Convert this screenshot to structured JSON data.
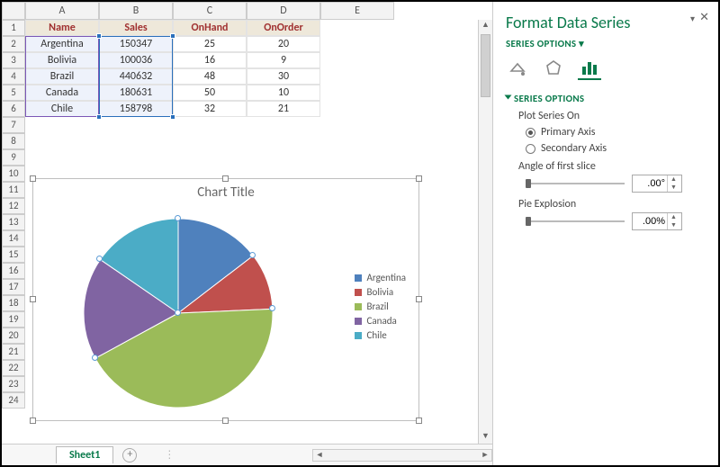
{
  "columns": [
    "A",
    "B",
    "C",
    "D",
    "E"
  ],
  "rowCount": 24,
  "table": {
    "headers": [
      "Name",
      "Sales",
      "OnHand",
      "OnOrder"
    ],
    "rows": [
      {
        "name": "Argentina",
        "sales": 150347,
        "onhand": 25,
        "onorder": 20
      },
      {
        "name": "Bolivia",
        "sales": 100036,
        "onhand": 16,
        "onorder": 9
      },
      {
        "name": "Brazil",
        "sales": 440632,
        "onhand": 48,
        "onorder": 30
      },
      {
        "name": "Canada",
        "sales": 180631,
        "onhand": 50,
        "onorder": 10
      },
      {
        "name": "Chile",
        "sales": 158798,
        "onhand": 32,
        "onorder": 21
      }
    ]
  },
  "chart_data": {
    "type": "pie",
    "title": "Chart Title",
    "categories": [
      "Argentina",
      "Bolivia",
      "Brazil",
      "Canada",
      "Chile"
    ],
    "values": [
      150347,
      100036,
      440632,
      180631,
      158798
    ],
    "colors": [
      "#4f81bd",
      "#c0504d",
      "#9bbb59",
      "#8064a2",
      "#4bacc6"
    ],
    "start_angle_deg": 0
  },
  "sheet": {
    "tab1": "Sheet1"
  },
  "pane": {
    "title": "Format Data Series",
    "menu": "SERIES OPTIONS",
    "section": "SERIES OPTIONS",
    "plot_label": "Plot Series On",
    "primary": "Primary Axis",
    "secondary": "Secondary Axis",
    "primary_selected": true,
    "angle_label": "Angle of first slice",
    "angle_value": ".00°",
    "explosion_label": "Pie Explosion",
    "explosion_value": ".00%"
  }
}
